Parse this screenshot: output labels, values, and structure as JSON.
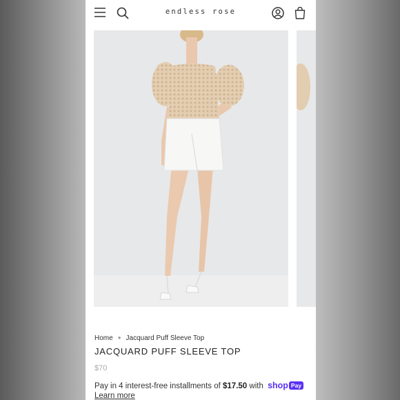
{
  "header": {
    "brand": "endless rose",
    "icons": [
      "menu-icon",
      "search-icon",
      "account-icon",
      "cart-icon"
    ]
  },
  "product": {
    "breadcrumb": {
      "home": "Home",
      "current": "Jacquard Puff Sleeve Top"
    },
    "title": "JACQUARD PUFF SLEEVE TOP",
    "price": "$70",
    "installments": {
      "prefix": "Pay in 4 interest-free installments of",
      "amount": "$17.50",
      "suffix": "with",
      "shop": "shop",
      "pay": "Pay",
      "learn_more": "Learn more"
    }
  },
  "colors": {
    "shop_pay": "#5a31f4",
    "photo_background": "#e6e7e9",
    "text": "#222222",
    "price": "#aaaaaa"
  }
}
